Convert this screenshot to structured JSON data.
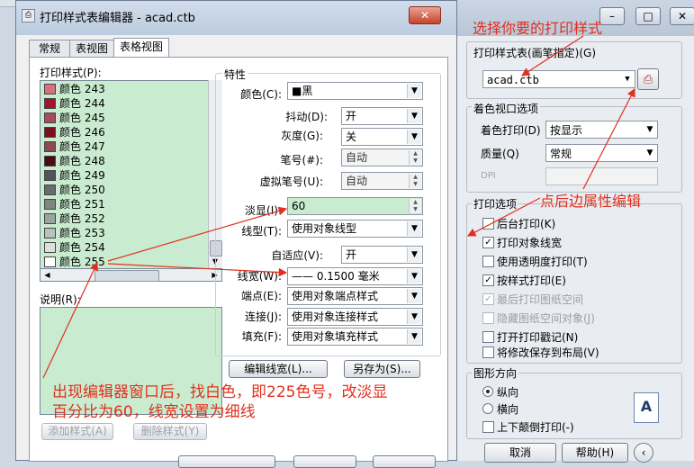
{
  "editor": {
    "title": "打印样式表编辑器 - acad.ctb",
    "tabs": [
      "常规",
      "表视图",
      "表格视图"
    ],
    "list_label": "打印样式(P):",
    "styles": [
      {
        "name": "颜色 243",
        "color": "#d9707e"
      },
      {
        "name": "颜色 244",
        "color": "#a4142c"
      },
      {
        "name": "颜色 245",
        "color": "#a84c5a"
      },
      {
        "name": "颜色 246",
        "color": "#7c0f1e"
      },
      {
        "name": "颜色 247",
        "color": "#8c4a52"
      },
      {
        "name": "颜色 248",
        "color": "#4b0b16"
      },
      {
        "name": "颜色 249",
        "color": "#4f5558"
      },
      {
        "name": "颜色 250",
        "color": "#666c6e"
      },
      {
        "name": "颜色 251",
        "color": "#7f8583"
      },
      {
        "name": "颜色 252",
        "color": "#9ca29e"
      },
      {
        "name": "颜色 253",
        "color": "#bbc1bc"
      },
      {
        "name": "颜色 254",
        "color": "#dcdfdc"
      },
      {
        "name": "颜色 255",
        "color": "#ffffff"
      }
    ],
    "desc_label": "说明(R):",
    "props_label": "特性",
    "color_label": "颜色(C):",
    "color_value": "■黑",
    "dither_label": "抖动(D):",
    "dither_value": "开",
    "gray_label": "灰度(G):",
    "gray_value": "关",
    "pen_label": "笔号(#):",
    "pen_value": "自动",
    "vpen_label": "虚拟笔号(U):",
    "vpen_value": "自动",
    "screen_label": "淡显(I):",
    "screen_value": "60",
    "linetype_label": "线型(T):",
    "linetype_value": "使用对象线型",
    "adaptive_label": "自适应(V):",
    "adaptive_value": "开",
    "lineweight_label": "线宽(W):",
    "lineweight_value": "—— 0.1500 毫米",
    "endstyle_label": "端点(E):",
    "endstyle_value": "使用对象端点样式",
    "joinstyle_label": "连接(J):",
    "joinstyle_value": "使用对象连接样式",
    "fillstyle_label": "填充(F):",
    "fillstyle_value": "使用对象填充样式",
    "edit_lw_button": "编辑线宽(L)...",
    "save_as_button": "另存为(S)...",
    "add_style_button": "添加样式(A)",
    "del_style_button": "删除样式(Y)"
  },
  "plot_dialog": {
    "style_table_label": "打印样式表(画笔指定)(G)",
    "style_table_value": "acad.ctb",
    "shaded_group": "着色视口选项",
    "shade_plot_label": "着色打印(D)",
    "shade_plot_value": "按显示",
    "quality_label": "质量(Q)",
    "quality_value": "常规",
    "dpi_label": "DPI",
    "options_group": "打印选项",
    "options": [
      {
        "label": "后台打印(K)",
        "checked": false,
        "disabled": false
      },
      {
        "label": "打印对象线宽",
        "checked": true,
        "disabled": false
      },
      {
        "label": "使用透明度打印(T)",
        "checked": false,
        "disabled": false
      },
      {
        "label": "按样式打印(E)",
        "checked": true,
        "disabled": false
      },
      {
        "label": "最后打印图纸空间",
        "checked": true,
        "disabled": true
      },
      {
        "label": "隐藏图纸空间对象(J)",
        "checked": false,
        "disabled": true
      },
      {
        "label": "打开打印戳记(N)",
        "checked": false,
        "disabled": false
      },
      {
        "label": "将修改保存到布局(V)",
        "checked": false,
        "disabled": false
      }
    ],
    "orientation_group": "图形方向",
    "portrait_label": "纵向",
    "landscape_label": "横向",
    "upside_down_label": "上下颠倒打印(-)",
    "cancel_button": "取消",
    "help_button": "帮助(H)"
  },
  "annotations": {
    "top_note": "选择你要的打印样式",
    "edit_note": "点后边属性编辑",
    "bottom_note_line1": "出现编辑器窗口后，找白色，即225色号，改淡显",
    "bottom_note_line2": "百分比为60，线宽设置为细线",
    "note_color": "#e0301e"
  }
}
